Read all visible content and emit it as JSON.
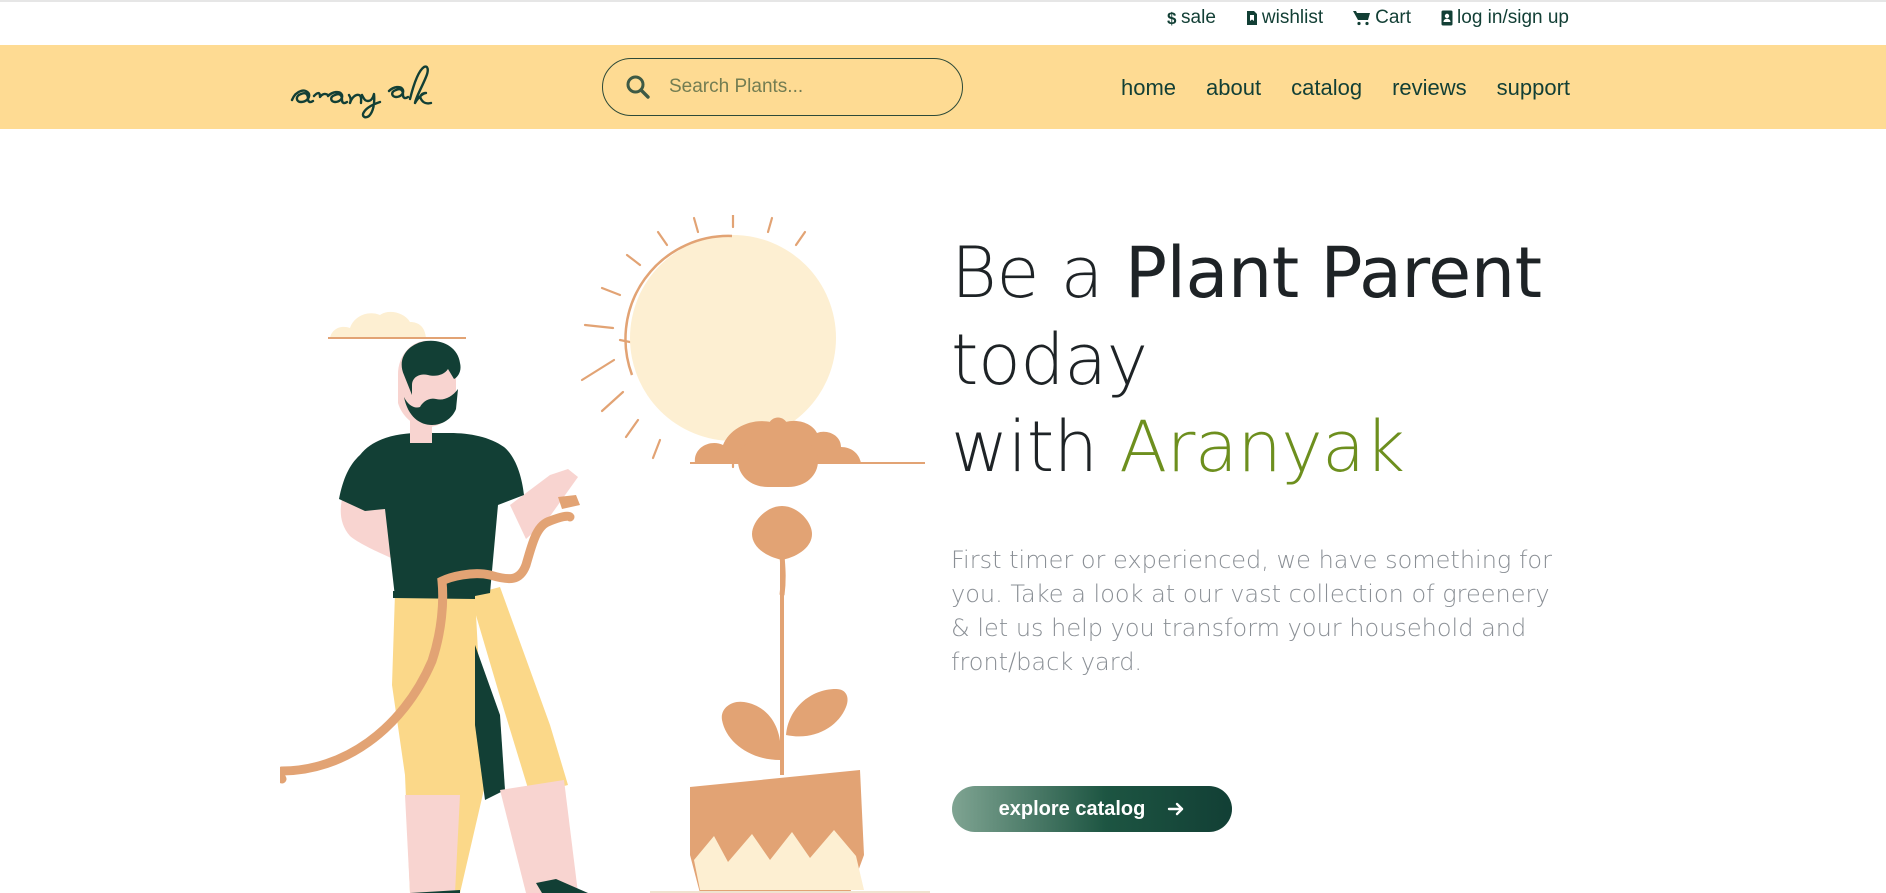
{
  "topbar": {
    "links": [
      {
        "label": "sale",
        "icon": "dollar-icon"
      },
      {
        "label": "wishlist",
        "icon": "bookmark-file-icon"
      },
      {
        "label": "Cart",
        "icon": "cart-icon"
      },
      {
        "label": "log in/sign up",
        "icon": "contact-card-icon"
      }
    ]
  },
  "header": {
    "logo_text": "aranyak",
    "search": {
      "placeholder": "Search Plants...",
      "value": "",
      "icon": "search-icon"
    },
    "nav": [
      {
        "label": "home"
      },
      {
        "label": "about"
      },
      {
        "label": "catalog"
      },
      {
        "label": "reviews"
      },
      {
        "label": "support"
      }
    ]
  },
  "hero": {
    "headline": {
      "part1": "Be a ",
      "part1_bold": "Plant Parent",
      "part2": "today",
      "part3": "with ",
      "brand": "Aranyak"
    },
    "subtext": "First timer or experienced, we have something for you. Take a look at our vast collection of greenery & let us help you transform your household and front/back yard.",
    "cta": {
      "label": "explore catalog",
      "icon": "arrow-right-icon"
    }
  },
  "colors": {
    "header_bg": "#fedb93",
    "primary_dark": "#123f35",
    "brand_green": "#6d8f1e",
    "accent_orange": "#e2a374",
    "sun_cream": "#fdefd2",
    "skin_pink": "#f8d4d0",
    "pants_yellow": "#fbd889"
  }
}
